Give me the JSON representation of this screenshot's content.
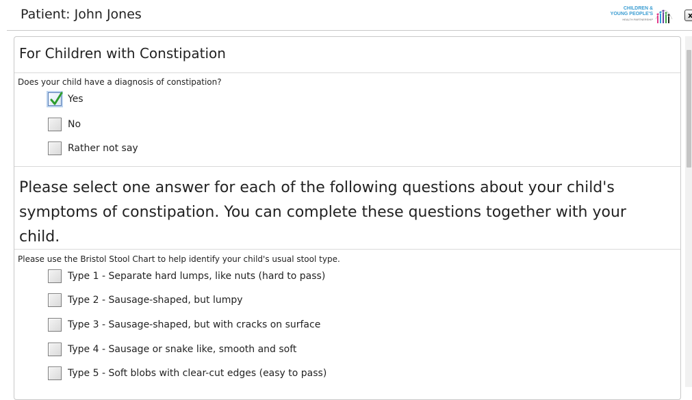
{
  "header": {
    "title": "Patient: John Jones",
    "logo": {
      "line1": "CHILDREN &",
      "line2": "YOUNG PEOPLE'S",
      "line3": "HEALTH PARTNERSHIP"
    },
    "close_label": "x"
  },
  "form": {
    "section_title": "For Children with Constipation",
    "diagnosis": {
      "question": "Does your child have a diagnosis of constipation?",
      "options": [
        {
          "label": "Yes",
          "checked": true
        },
        {
          "label": "No",
          "checked": false
        },
        {
          "label": "Rather not say",
          "checked": false
        }
      ]
    },
    "instructions": "Please select one answer for each of the following questions about your child's symptoms of constipation. You can complete these questions together with your child.",
    "stool_type": {
      "question": "Please use the Bristol Stool Chart to help identify your child's usual stool type.",
      "options": [
        {
          "label": "Type 1 - Separate hard lumps, like nuts (hard to pass)",
          "checked": false
        },
        {
          "label": "Type 2 - Sausage-shaped, but lumpy",
          "checked": false
        },
        {
          "label": "Type 3 - Sausage-shaped, but with cracks on surface",
          "checked": false
        },
        {
          "label": "Type 4 - Sausage or snake like, smooth and soft",
          "checked": false
        },
        {
          "label": "Type 5 - Soft blobs with clear-cut edges (easy to pass)",
          "checked": false
        }
      ]
    }
  },
  "colors": {
    "checkmark": "#2e9d2e",
    "accent": "#3b9dd2"
  },
  "icons": {
    "checked": "checkmark-icon",
    "close": "close-icon",
    "logo": "partnership-logo"
  }
}
